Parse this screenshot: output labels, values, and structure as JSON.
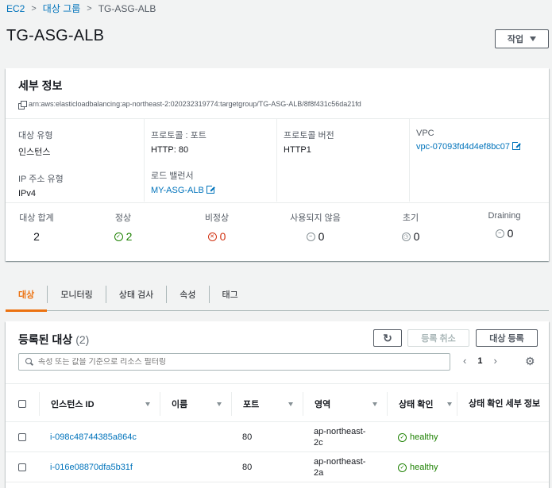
{
  "breadcrumb": {
    "root": "EC2",
    "parent": "대상 그룹",
    "current": "TG-ASG-ALB"
  },
  "page_title": "TG-ASG-ALB",
  "actions_label": "작업",
  "details": {
    "title": "세부 정보",
    "arn": "arn:aws:elasticloadbalancing:ap-northeast-2:020232319774:targetgroup/TG-ASG-ALB/8f8f431c56da21fd",
    "target_type_label": "대상 유형",
    "target_type_value": "인스턴스",
    "ip_type_label": "IP 주소 유형",
    "ip_type_value": "IPv4",
    "protocol_port_label": "프로토콜 : 포트",
    "protocol_port_value": "HTTP: 80",
    "load_balancer_label": "로드 밸런서",
    "load_balancer_value": "MY-ASG-ALB",
    "protocol_version_label": "프로토콜 버전",
    "protocol_version_value": "HTTP1",
    "vpc_label": "VPC",
    "vpc_value": "vpc-07093fd4d4ef8bc07"
  },
  "counts": {
    "total_label": "대상 합계",
    "total_value": "2",
    "healthy_label": "정상",
    "healthy_value": "2",
    "unhealthy_label": "비정상",
    "unhealthy_value": "0",
    "unused_label": "사용되지 않음",
    "unused_value": "0",
    "initial_label": "초기",
    "initial_value": "0",
    "draining_label": "Draining",
    "draining_value": "0"
  },
  "tabs": [
    "대상",
    "모니터링",
    "상태 검사",
    "속성",
    "태그"
  ],
  "targets": {
    "title": "등록된 대상",
    "count": "(2)",
    "deregister_label": "등록 취소",
    "register_label": "대상 등록",
    "filter_placeholder": "속성 또는 값을 기준으로 리소스 필터링",
    "page": "1",
    "columns": [
      "인스턴스 ID",
      "이름",
      "포트",
      "영역",
      "상태 확인",
      "상태 확인 세부 정보"
    ],
    "rows": [
      {
        "id": "i-098c48744385a864c",
        "name": "",
        "port": "80",
        "zone_1": "ap-northeast-",
        "zone_2": "2c",
        "health": "healthy"
      },
      {
        "id": "i-016e08870dfa5b31f",
        "name": "",
        "port": "80",
        "zone_1": "ap-northeast-",
        "zone_2": "2a",
        "health": "healthy"
      }
    ]
  }
}
